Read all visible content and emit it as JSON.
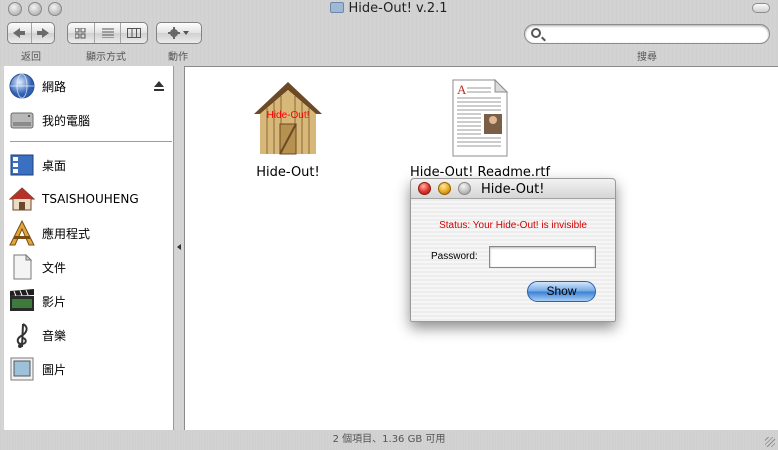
{
  "window": {
    "title": "Hide-Out! v.2.1"
  },
  "toolbar": {
    "back_label": "返回",
    "view_label": "顯示方式",
    "action_label": "動作",
    "search_label": "搜尋",
    "search_value": ""
  },
  "sidebar": {
    "items": [
      {
        "label": "網路",
        "icon": "network-globe-icon"
      },
      {
        "label": "我的電腦",
        "icon": "hard-drive-icon"
      },
      {
        "label": "桌面",
        "icon": "desktop-icon"
      },
      {
        "label": "TSAISHOUHENG",
        "icon": "home-icon"
      },
      {
        "label": "應用程式",
        "icon": "applications-icon"
      },
      {
        "label": "文件",
        "icon": "documents-icon"
      },
      {
        "label": "影片",
        "icon": "movies-icon"
      },
      {
        "label": "音樂",
        "icon": "music-icon"
      },
      {
        "label": "圖片",
        "icon": "pictures-icon"
      }
    ]
  },
  "files": [
    {
      "name": "Hide-Out!",
      "icon": "shed-app-icon",
      "icon_text": "Hide-Out!"
    },
    {
      "name": "Hide-Out! Readme.rtf",
      "icon": "rtf-document-icon"
    }
  ],
  "status_bar": {
    "text": "2 個項目、1.36 GB 可用"
  },
  "dialog": {
    "title": "Hide-Out!",
    "status": "Status: Your Hide-Out! is invisible",
    "password_label": "Password:",
    "password_value": "",
    "show_button": "Show"
  },
  "colors": {
    "status_red": "#d40000",
    "aqua_blue": "#3b7fd3"
  }
}
